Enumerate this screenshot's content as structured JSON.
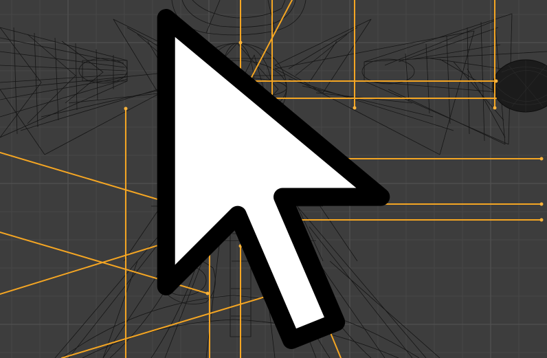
{
  "viewport": {
    "kind": "3d-viewport",
    "shading_mode": "wireframe",
    "view": "orthographic-front"
  },
  "colors": {
    "background": "#3d3d3d",
    "grid_minor": "#474747",
    "grid_major": "#525252",
    "wireframe": "#111111",
    "armature": "#f5a623",
    "armature_joint": "#f7b23b",
    "mesh_dense": "#1b1b1b"
  },
  "icons": {
    "cursor": "mouse-pointer-icon"
  },
  "armature": {
    "bone_count": 14
  }
}
